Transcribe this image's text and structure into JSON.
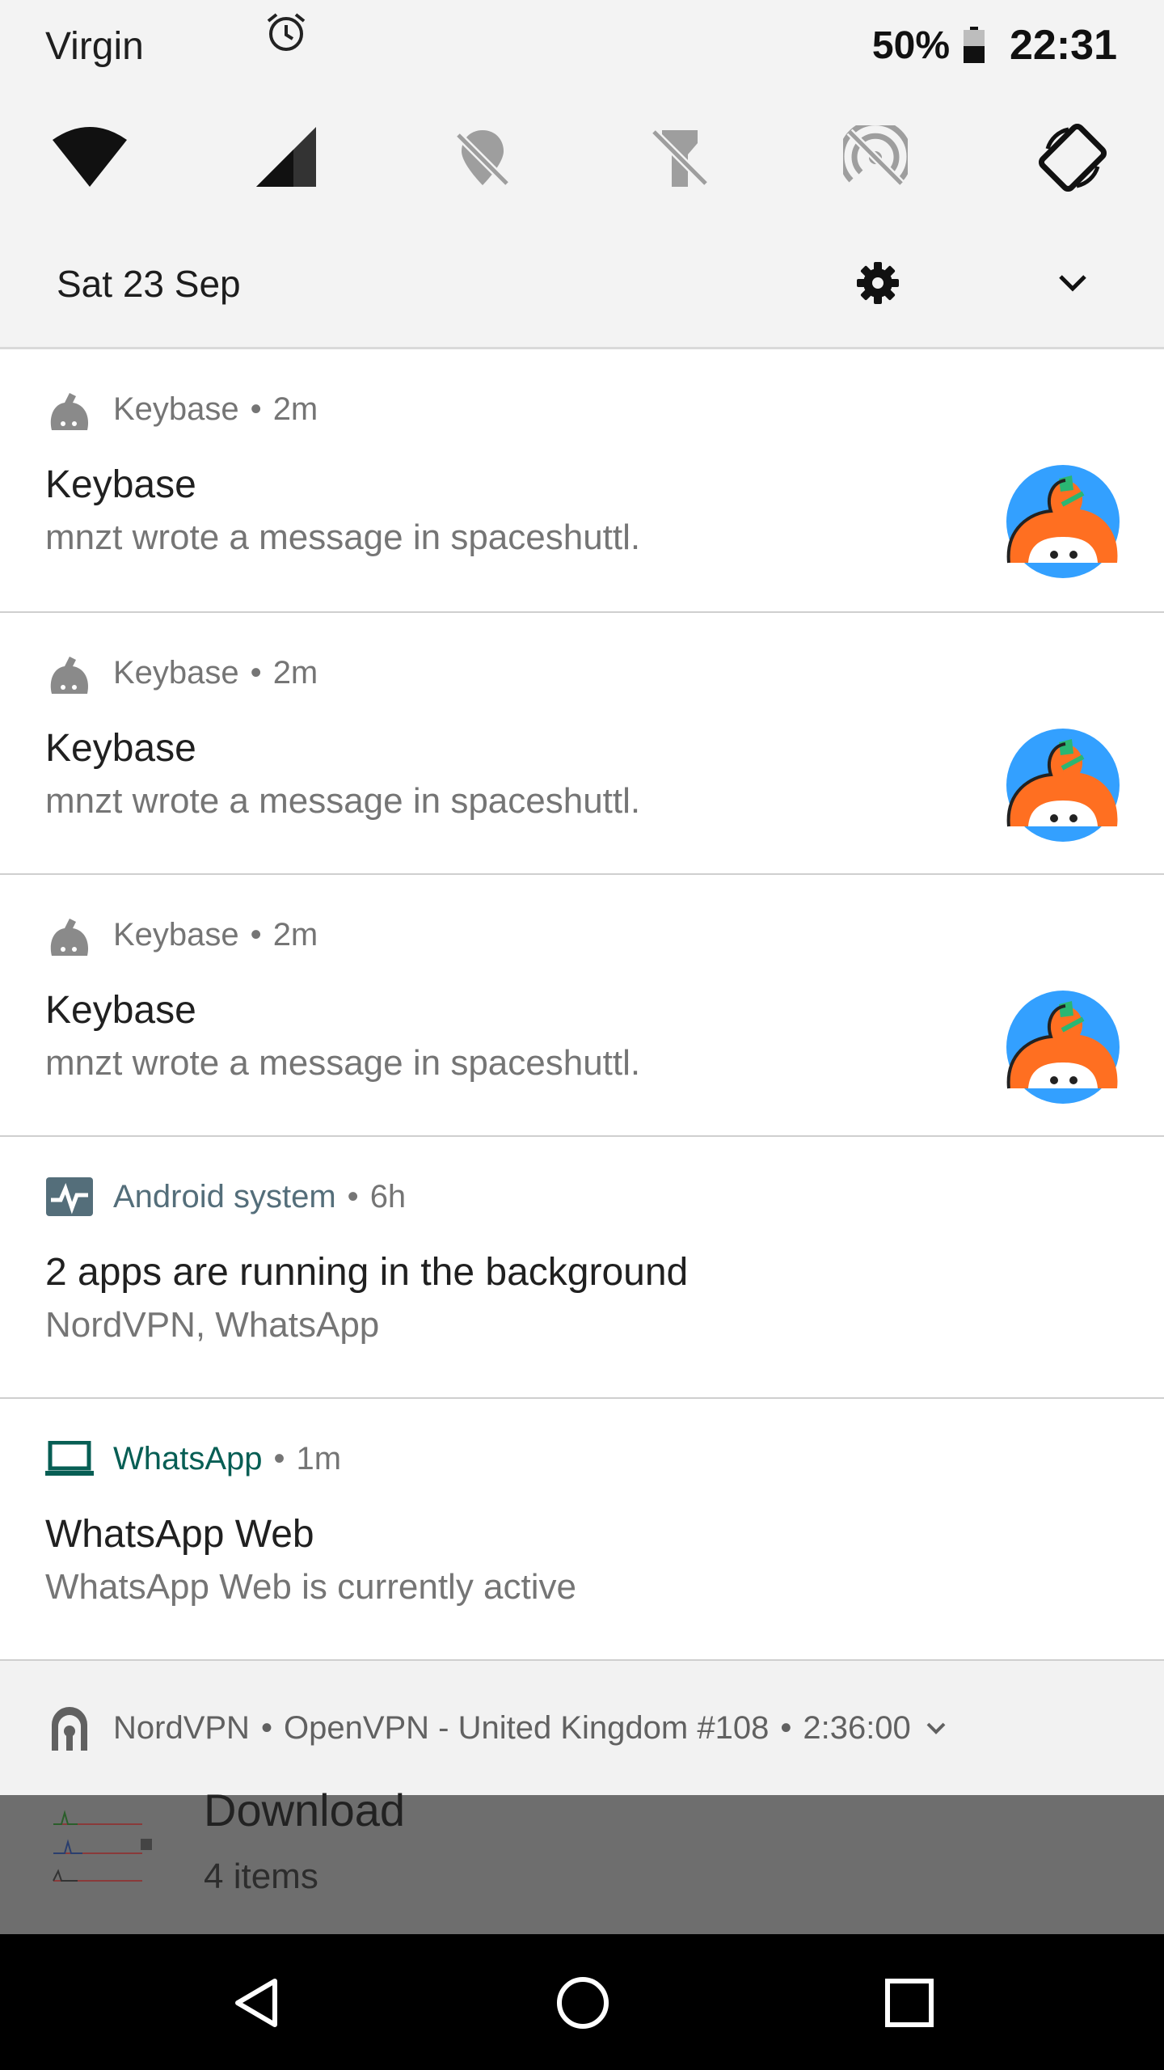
{
  "status_bar": {
    "carrier": "Virgin",
    "battery": "50%",
    "time": "22:31"
  },
  "quick_settings": {
    "tiles": [
      "wifi-icon",
      "cellular-signal-icon",
      "location-off-icon",
      "flashlight-off-icon",
      "hotspot-off-icon",
      "auto-rotate-icon"
    ],
    "date": "Sat 23 Sep"
  },
  "notifications": [
    {
      "app": "Keybase",
      "time": "2m",
      "title": "Keybase",
      "body": "mnzt wrote a message in spaceshuttl."
    },
    {
      "app": "Keybase",
      "time": "2m",
      "title": "Keybase",
      "body": "mnzt wrote a message in spaceshuttl."
    },
    {
      "app": "Keybase",
      "time": "2m",
      "title": "Keybase",
      "body": "mnzt wrote a message in spaceshuttl."
    },
    {
      "app": "Android system",
      "time": "6h",
      "title": "2 apps are running in the background",
      "body": "NordVPN, WhatsApp",
      "app_color": "#546e7a"
    },
    {
      "app": "WhatsApp",
      "time": "1m",
      "title": "WhatsApp Web",
      "body": "WhatsApp Web is currently active",
      "app_color": "#075e54"
    }
  ],
  "nordvpn": {
    "app": "NordVPN",
    "server": "OpenVPN - United Kingdom #108",
    "elapsed": "2:36:00"
  },
  "download": {
    "title": "Download",
    "subtitle": "4 items"
  },
  "colors": {
    "header_bg": "#f3f3f3",
    "keybase_blue": "#33a0ff",
    "keybase_orange": "#ff6f21",
    "android_accent": "#546e7a",
    "whatsapp_accent": "#075e54"
  }
}
